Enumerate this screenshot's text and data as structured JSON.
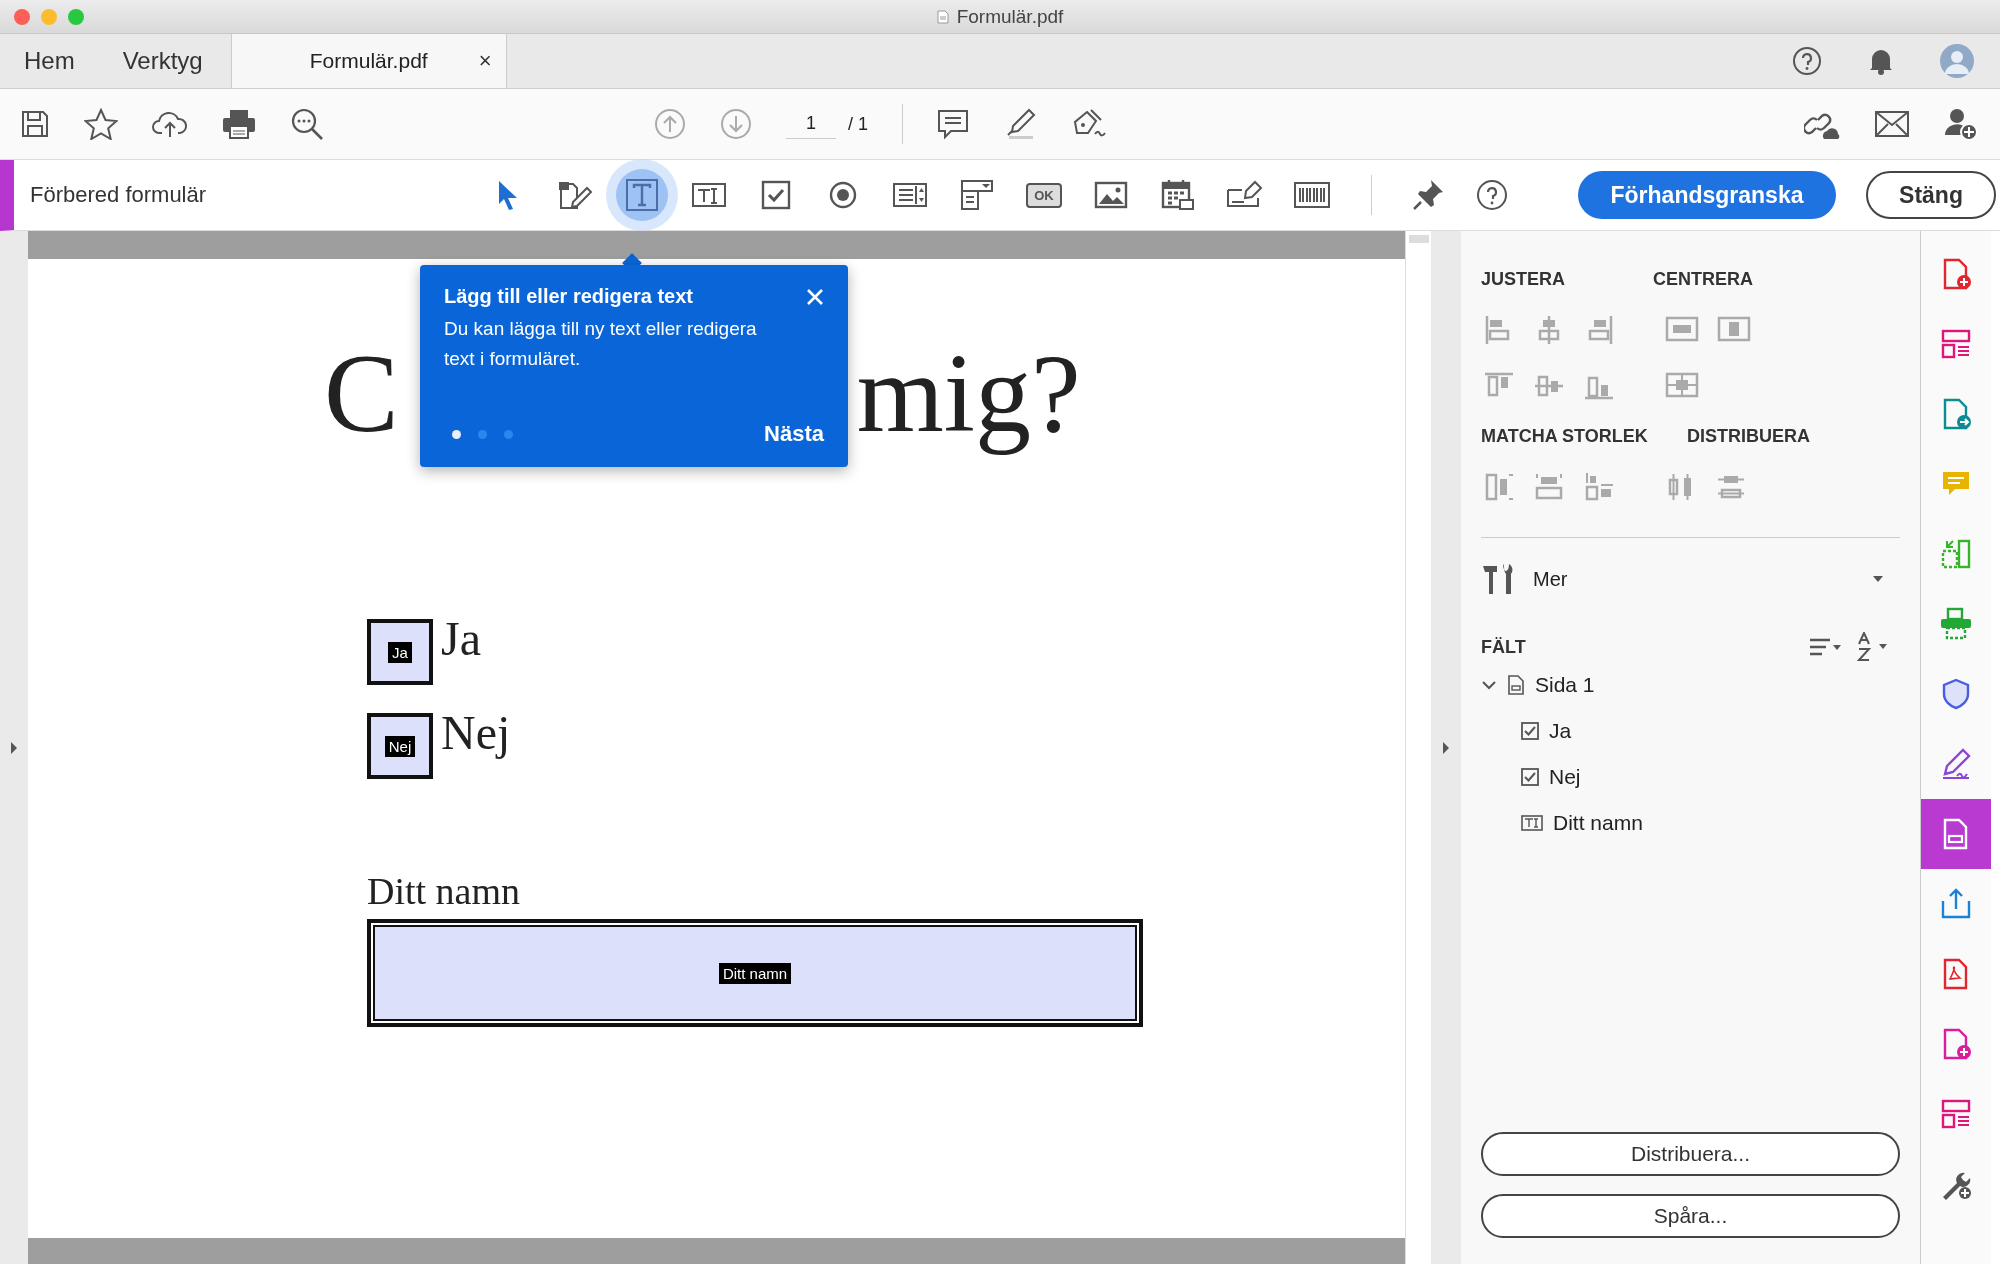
{
  "window": {
    "title": "Formulär.pdf"
  },
  "tabs": [
    {
      "label": "Hem",
      "selected": false
    },
    {
      "label": "Verktyg",
      "selected": false
    },
    {
      "label": "Formulär.pdf",
      "selected": true,
      "close": "×"
    }
  ],
  "toolbar": {
    "page_number": "1",
    "page_total": "/ 1"
  },
  "form_toolbar": {
    "title": "Förbered formulär",
    "tools": [
      {
        "kind": "select",
        "selected": false
      },
      {
        "kind": "edit",
        "selected": false
      },
      {
        "kind": "text",
        "selected": true
      },
      {
        "kind": "textfield",
        "selected": false
      },
      {
        "kind": "checkbox",
        "selected": false
      },
      {
        "kind": "radio",
        "selected": false
      },
      {
        "kind": "listbox",
        "selected": false
      },
      {
        "kind": "dropdown",
        "selected": false
      },
      {
        "kind": "button",
        "selected": false,
        "label": "OK"
      },
      {
        "kind": "image",
        "selected": false
      },
      {
        "kind": "date",
        "selected": false
      },
      {
        "kind": "signature",
        "selected": false
      },
      {
        "kind": "barcode",
        "selected": false
      }
    ],
    "preview_button": "Förhandsgranska",
    "close_button": "Stäng"
  },
  "tooltip": {
    "title": "Lägg till eller redigera text",
    "body": "Du kan lägga till ny text eller redigera text i formuläret.",
    "next": "Nästa",
    "steps": [
      {
        "selected": true
      },
      {
        "selected": false
      },
      {
        "selected": false
      }
    ]
  },
  "document": {
    "heading_parts": [
      "C",
      "mig?"
    ],
    "checkboxes": [
      {
        "label": "Ja",
        "tag": "Ja"
      },
      {
        "label": "Nej",
        "tag": "Nej"
      }
    ],
    "name_field": {
      "label": "Ditt namn",
      "tag": "Ditt namn"
    }
  },
  "panel": {
    "align_title": "JUSTERA",
    "center_title": "CENTRERA",
    "match_title": "MATCHA STORLEK",
    "distribute_title": "DISTRIBUERA",
    "more": "Mer",
    "fields_title": "FÄLT",
    "tree": [
      {
        "label": "Sida 1",
        "kind": "page",
        "expanded": true,
        "children": [
          {
            "label": "Ja",
            "kind": "checkbox"
          },
          {
            "label": "Nej",
            "kind": "checkbox"
          },
          {
            "label": "Ditt namn",
            "kind": "text"
          }
        ]
      }
    ],
    "buttons": [
      "Distribuera...",
      "Spåra..."
    ]
  },
  "tool_strip": [
    {
      "kind": "create",
      "color": "#e0262f",
      "selected": false
    },
    {
      "kind": "organize",
      "color": "#e0157a",
      "selected": false
    },
    {
      "kind": "export",
      "color": "#0c8c92",
      "selected": false
    },
    {
      "kind": "comment",
      "color": "#e8b400",
      "selected": false
    },
    {
      "kind": "scan",
      "color": "#36b52a",
      "selected": false
    },
    {
      "kind": "print",
      "color": "#23a735",
      "selected": false
    },
    {
      "kind": "protect",
      "color": "#4a5de0",
      "selected": false
    },
    {
      "kind": "sign",
      "color": "#8c45d8",
      "selected": false
    },
    {
      "kind": "form",
      "color": "#b93ad0",
      "selected": true
    },
    {
      "kind": "send",
      "color": "#1a82d8",
      "selected": false
    },
    {
      "kind": "pdf",
      "color": "#e0262f",
      "selected": false
    },
    {
      "kind": "add",
      "color": "#d81f9b",
      "selected": false
    },
    {
      "kind": "stamp",
      "color": "#e0157a",
      "selected": false
    },
    {
      "kind": "more",
      "color": "#555555",
      "selected": false
    }
  ]
}
